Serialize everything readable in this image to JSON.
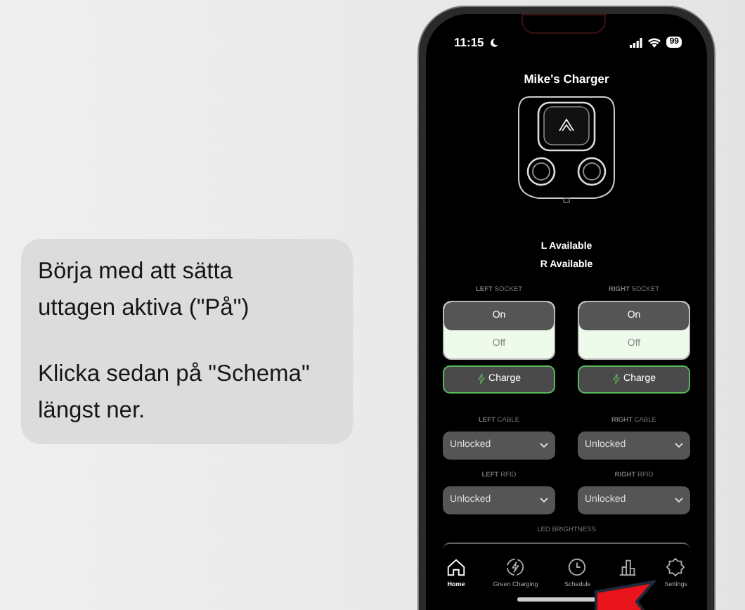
{
  "caption": [
    {
      "lines": [
        "Börja med att sätta",
        "uttagen aktiva (\"På\")"
      ]
    },
    {
      "lines": [
        "Klicka sedan på \"Schema\"",
        "längst ner."
      ]
    }
  ],
  "status_bar": {
    "time": "11:15",
    "battery": "99"
  },
  "title": "Mike's Charger",
  "status_lines": [
    "L Available",
    "R Available"
  ],
  "sides": [
    {
      "socket_label": "**LEFT** SOCKET",
      "options": [
        {
          "label": "On",
          "selected": true
        },
        {
          "label": "Off",
          "selected": false
        }
      ],
      "action": "Charge",
      "cable_label": "**LEFT** CABLE",
      "cable_value": "Unlocked",
      "rfid_label": "**LEFT** RFID",
      "rfid_value": "Unlocked"
    },
    {
      "socket_label": "**RIGHT** SOCKET",
      "options": [
        {
          "label": "On",
          "selected": true
        },
        {
          "label": "Off",
          "selected": false
        }
      ],
      "action": "Charge",
      "cable_label": "**RIGHT** CABLE",
      "cable_value": "Unlocked",
      "rfid_label": "**RIGHT** RFID",
      "rfid_value": "Unlocked"
    }
  ],
  "led_label": "LED BRIGHTNESS",
  "tabs": [
    {
      "kind": "home",
      "label": "Home",
      "selected": true
    },
    {
      "kind": "green",
      "label": "Green Charging",
      "selected": false
    },
    {
      "kind": "schedule",
      "label": "Schedule",
      "selected": false
    },
    {
      "kind": "stats",
      "selected": false
    },
    {
      "kind": "settings",
      "label": "Settings",
      "selected": false
    }
  ]
}
